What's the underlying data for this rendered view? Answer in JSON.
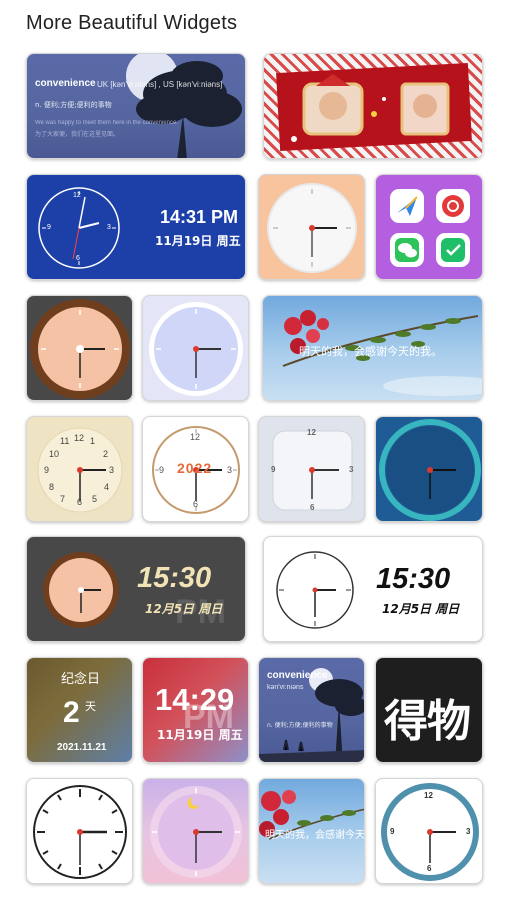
{
  "header": {
    "title": "More Beautiful Widgets"
  },
  "dictionary": {
    "word": "convenience",
    "pronunciation": "UK [kən'viːniəns] , US [kən'viːniəns]",
    "meaning": "n. 便利;方便;便利的事物",
    "example_en": "We was happy to meet them here in the convenience.",
    "example_cn": "为了大家便，我们在这里见面。"
  },
  "blue_digital": {
    "time": "14:31 PM",
    "date": "11月19日 周五"
  },
  "quote": {
    "text": "明天的我，会感谢今天的我。"
  },
  "big_digital_dark": {
    "time": "15:30",
    "date": "12月5日 周日",
    "ampm": "PM"
  },
  "big_digital_light": {
    "time": "15:30",
    "date": "12月5日 周日"
  },
  "anniversary": {
    "label": "纪念日",
    "days": "2",
    "unit": "天",
    "date": "2021.11.21"
  },
  "red_digital": {
    "time": "14:29",
    "date": "11月19日 周五",
    "ampm": "PM"
  },
  "dict_small": {
    "word": "convenience",
    "pron": "kən'viːniəns",
    "meaning": "n. 便利;方便;便利的事物"
  },
  "dewu": {
    "brand": "得物"
  },
  "quote_small": {
    "text": "明天的我，会感谢今天的我"
  },
  "clock_numbers": {
    "twelve": "12",
    "three": "3",
    "six": "6",
    "nine": "9",
    "eleven": "11",
    "ten": "10",
    "eight": "8",
    "seven": "7",
    "five": "5",
    "four": "4",
    "two": "2",
    "one": "1"
  },
  "year_badge": "2022",
  "colors": {
    "accent_red": "#d93a2b",
    "blue_widget": "#1d3fa8",
    "purple_widget": "#b45ee0"
  }
}
